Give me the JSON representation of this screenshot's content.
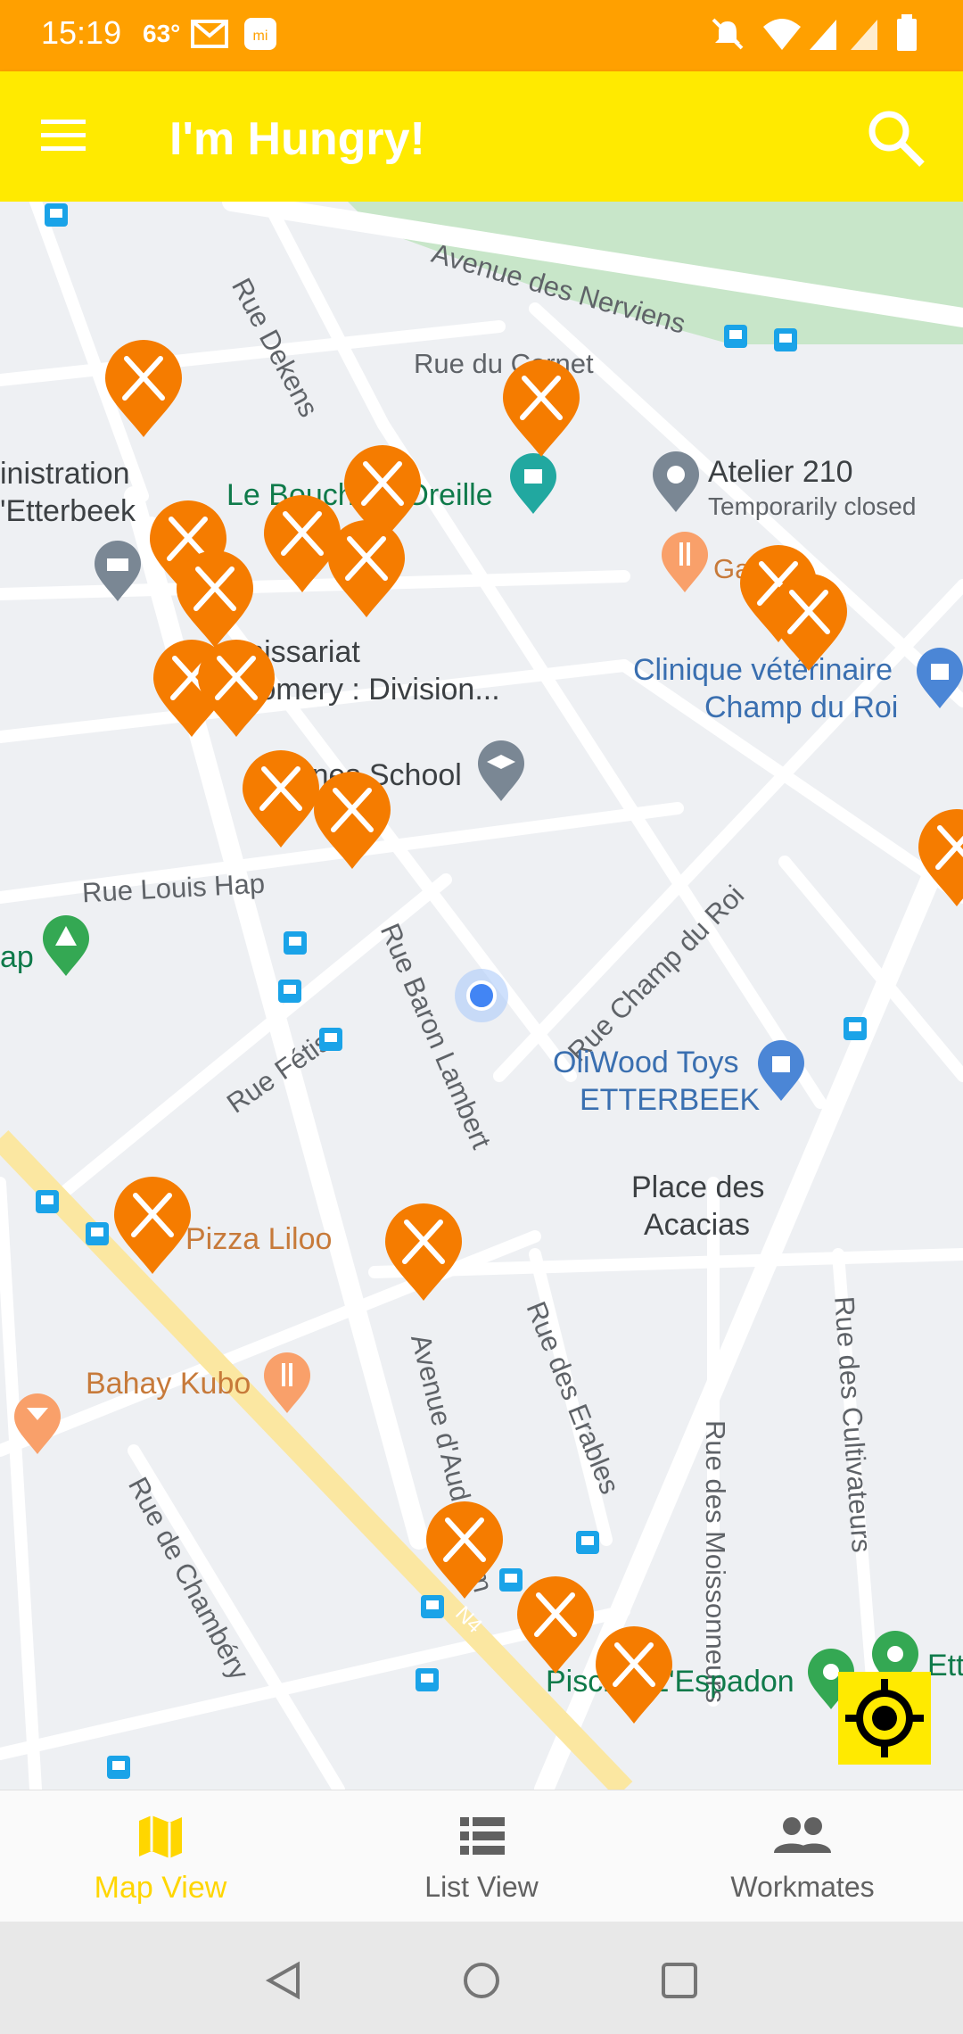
{
  "status": {
    "time": "15:19",
    "temperature": "63°"
  },
  "app": {
    "title": "I'm Hungry!"
  },
  "map": {
    "streets": [
      {
        "id": "rue-dekens",
        "text": "Rue Dekens"
      },
      {
        "id": "avenue-nerviens",
        "text": "Avenue des Nerviens"
      },
      {
        "id": "rue-cornet",
        "text": "Rue du Cornet"
      },
      {
        "id": "rue-louis-hap",
        "text": "Rue Louis Hap"
      },
      {
        "id": "rue-baron-lambert",
        "text": "Rue Baron Lambert"
      },
      {
        "id": "rue-champ-du-roi",
        "text": "Rue Champ du Roi"
      },
      {
        "id": "rue-fetis",
        "text": "Rue Fétis"
      },
      {
        "id": "rue-erables",
        "text": "Rue des Erables"
      },
      {
        "id": "rue-cultivateurs",
        "text": "Rue des Cultivateurs"
      },
      {
        "id": "avenue-auderghem",
        "text": "Avenue d'Auderghem"
      },
      {
        "id": "rue-moissonneurs",
        "text": "Rue des Moissonneurs"
      },
      {
        "id": "rue-chambery",
        "text": "Rue de Chambéry"
      }
    ],
    "places": [
      {
        "id": "administration",
        "text": "inistration"
      },
      {
        "id": "etterbeek",
        "text": "'Etterbeek"
      },
      {
        "id": "le-bouche",
        "text": "Le Bouche à Oreille"
      },
      {
        "id": "atelier",
        "text": "Atelier 210"
      },
      {
        "id": "temp-closed",
        "text": "Temporarily closed"
      },
      {
        "id": "gazette",
        "text": "Gazette"
      },
      {
        "id": "commissariat",
        "text": "Commissariat"
      },
      {
        "id": "montgomery",
        "text": "Montgomery : Division..."
      },
      {
        "id": "clinique",
        "text": "Clinique vétérinaire"
      },
      {
        "id": "champ-du-roi",
        "text": "Champ du Roi"
      },
      {
        "id": "agnes-school",
        "text": "Agnes School"
      },
      {
        "id": "ap",
        "text": "ap"
      },
      {
        "id": "oliwood",
        "text": "OliWood Toys"
      },
      {
        "id": "oliwood-etterbeek",
        "text": "ETTERBEEK"
      },
      {
        "id": "place-acacias-1",
        "text": "Place des"
      },
      {
        "id": "place-acacias-2",
        "text": "Acacias"
      },
      {
        "id": "pizza-liloo",
        "text": "Pizza Liloo"
      },
      {
        "id": "bahay-kubo",
        "text": "Bahay Kubo"
      },
      {
        "id": "piscine",
        "text": "Piscine L'Espadon"
      },
      {
        "id": "ett",
        "text": "Ett"
      },
      {
        "id": "n4",
        "text": "N4"
      }
    ]
  },
  "nav": {
    "map": {
      "label": "Map View",
      "icon": "map-icon"
    },
    "list": {
      "label": "List View",
      "icon": "list-icon"
    },
    "workmates": {
      "label": "Workmates",
      "icon": "people-icon"
    }
  },
  "colors": {
    "status": "#ffa000",
    "appbar": "#ffea00",
    "pin": "#f57c00",
    "active": "#ffd600"
  }
}
